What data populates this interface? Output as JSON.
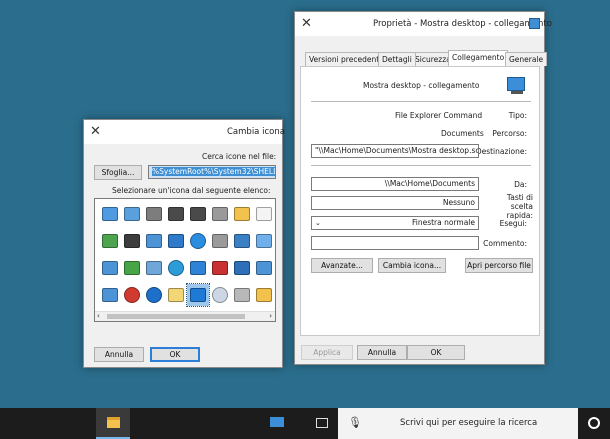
{
  "properties_dialog": {
    "title": "Proprietà - Mostra desktop - collegamento",
    "tabs": [
      "Generale",
      "Collegamento",
      "Sicurezza",
      "Dettagli",
      "Versioni precedenti"
    ],
    "active_tab": "Collegamento",
    "shortcut_name": "Mostra desktop - collegamento",
    "type_label": "Tipo:",
    "type_value": "File Explorer Command",
    "location_label": "Percorso:",
    "location_value": "Documents",
    "target_label": "Destinazione:",
    "target_value": "\"\\\\Mac\\Home\\Documents\\Mostra desktop.scf\"",
    "start_in_label": "Da:",
    "start_in_value": "\\\\Mac\\Home\\Documents",
    "shortcut_key_label": "Tasti di scelta rapida:",
    "shortcut_key_value": "Nessuno",
    "run_label": "Esegui:",
    "run_value": "Finestra normale",
    "comment_label": "Commento:",
    "comment_value": "",
    "open_location_button": "Apri percorso file",
    "change_icon_button": "Cambia icona...",
    "advanced_button": "Avanzate...",
    "ok_button": "OK",
    "cancel_button": "Annulla",
    "apply_button": "Applica"
  },
  "change_icon_dialog": {
    "title": "Cambia icona",
    "search_label": "Cerca icone nel file:",
    "search_value": "%SystemRoot%\\System32\\SHELL32.dll",
    "browse_button": "Sfoglia...",
    "select_label": "Selezionare un'icona dal seguente elenco:",
    "ok_button": "OK",
    "cancel_button": "Annulla"
  },
  "taskbar": {
    "search_placeholder": "Scrivi qui per eseguire la ricerca"
  },
  "icons": {
    "rows": [
      [
        "blank-file-icon",
        "folder-icon",
        "drive-icon",
        "chip-icon",
        "chip-icon",
        "printer-icon",
        "monitor-settings-icon",
        "settings-window-icon"
      ],
      [
        "dialog-window-icon",
        "monitor-icon",
        "drive-icon",
        "globe-icon",
        "app-window-icon",
        "window-icon",
        "video-player-icon",
        "pencil-icon"
      ],
      [
        "window-icon",
        "floppy-icon",
        "delete-drive-icon",
        "network-icon",
        "ball-icon",
        "search-icon",
        "arrow-transfer-icon",
        "window-icon"
      ],
      [
        "folder-icon",
        "optical-drive-icon",
        "clock-icon",
        "desktop-icon",
        "notes-icon",
        "help-icon",
        "shutdown-icon",
        "window-icon"
      ]
    ]
  }
}
